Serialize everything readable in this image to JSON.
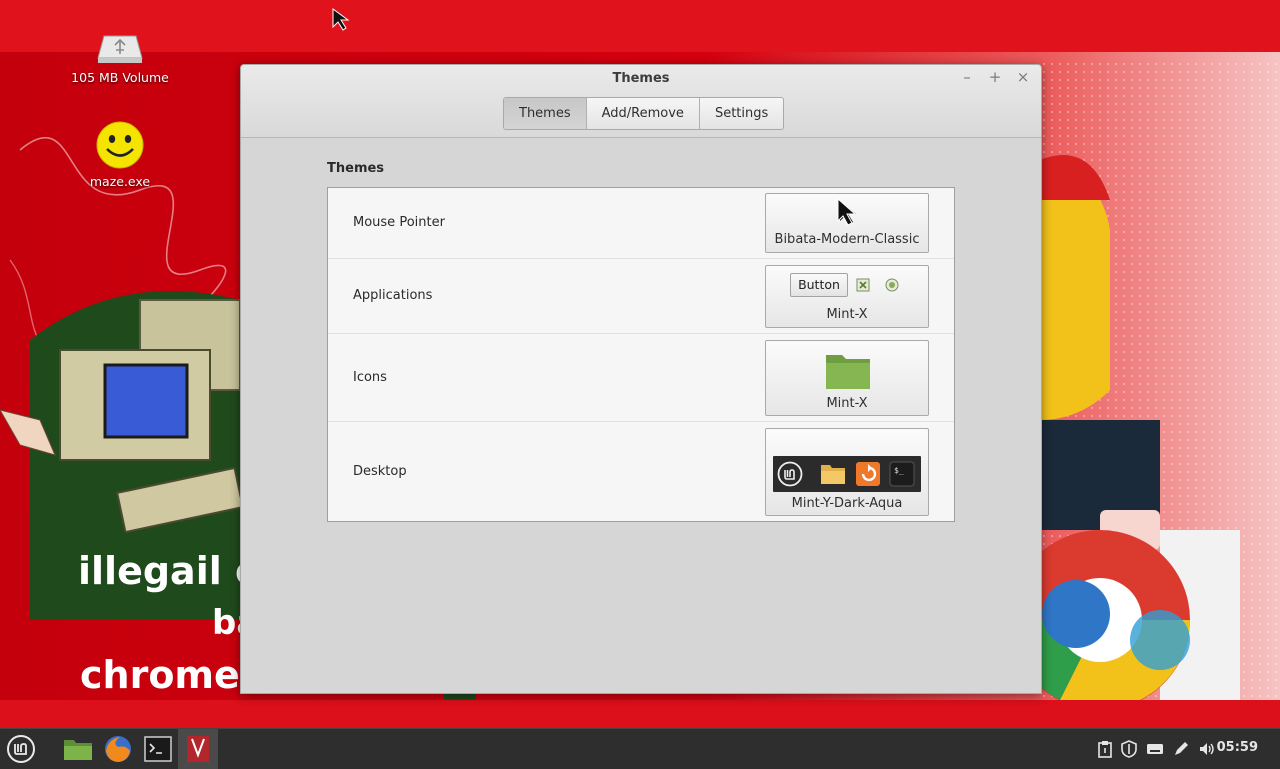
{
  "desktop": {
    "icons": [
      {
        "label": "105 MB Volume",
        "icon": "usb-drive-icon"
      },
      {
        "label": "maze.exe",
        "icon": "smiley-icon"
      }
    ],
    "wallpaper_text": [
      "illegail cl",
      "ba",
      "chrome s"
    ]
  },
  "window": {
    "title": "Themes",
    "controls": {
      "minimize": "–",
      "maximize": "+",
      "close": "×"
    },
    "tabs": [
      {
        "label": "Themes",
        "active": true
      },
      {
        "label": "Add/Remove",
        "active": false
      },
      {
        "label": "Settings",
        "active": false
      }
    ],
    "section_title": "Themes",
    "rows": [
      {
        "label": "Mouse Pointer",
        "value": "Bibata-Modern-Classic"
      },
      {
        "label": "Applications",
        "value": "Mint-X",
        "preview_button": "Button"
      },
      {
        "label": "Icons",
        "value": "Mint-X"
      },
      {
        "label": "Desktop",
        "value": "Mint-Y-Dark-Aqua"
      }
    ]
  },
  "taskbar": {
    "clock": "05:59",
    "launchers": [
      "mint-menu-icon",
      "files-icon",
      "firefox-icon",
      "terminal-icon",
      "themes-app-icon"
    ],
    "tray": [
      "clipboard-icon",
      "shield-icon",
      "keyboard-icon",
      "pen-icon",
      "volume-icon"
    ]
  },
  "colors": {
    "wallpaper_red": "#d4000f",
    "panel": "#2e2e2e",
    "folder_green": "#7fb24f"
  }
}
